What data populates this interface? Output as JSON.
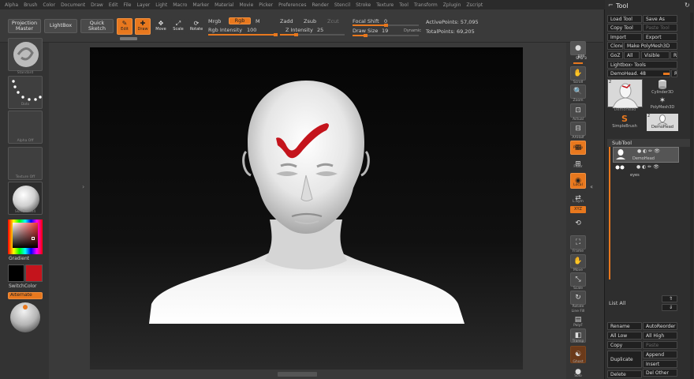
{
  "menubar": {
    "items": [
      "Alpha",
      "Brush",
      "Color",
      "Document",
      "Draw",
      "Edit",
      "File",
      "Layer",
      "Light",
      "Macro",
      "Marker",
      "Material",
      "Movie",
      "Picker",
      "Preferences",
      "Render",
      "Stencil",
      "Stroke",
      "Texture",
      "Tool",
      "Transform",
      "Zplugin",
      "Zscript"
    ]
  },
  "toolbar": {
    "projection_master": "Projection Master",
    "lightbox": "LightBox",
    "quick_sketch": "Quick Sketch",
    "edit": "Edit",
    "draw": "Draw",
    "move": "Move",
    "scale": "Scale",
    "rotate": "Rotate",
    "mrgb": "Mrgb",
    "rgb": "Rgb",
    "m": "M",
    "rgb_intensity_label": "Rgb Intensity",
    "rgb_intensity_value": "100",
    "zadd": "Zadd",
    "zsub": "Zsub",
    "zcut": "Zcut",
    "z_intensity_label": "Z Intensity",
    "z_intensity_value": "25",
    "focal_shift_label": "Focal Shift",
    "focal_shift_value": "0",
    "draw_size_label": "Draw Size",
    "draw_size_value": "19",
    "dynamic": "Dynamic",
    "active_points": "ActivePoints: 57,095",
    "total_points": "TotalPoints: 69,205",
    "rgb_intensity_fraction": 1.0,
    "z_intensity_fraction": 0.25,
    "focal_shift_fraction": 0.5,
    "draw_size_fraction": 0.2
  },
  "left_tray": {
    "standard": "Standard",
    "dots": "Dots",
    "alpha_off": "Alpha Off",
    "texture_off": "Texture Off",
    "matcap": "SkinShade4",
    "gradient": "Gradient",
    "switch_color": "SwitchColor",
    "alternate": "Alternate"
  },
  "right_tray": {
    "bpr": "BPR",
    "spix_label": "SPix",
    "spix_value": "3",
    "scroll": "Scroll",
    "zoom": "Zoom",
    "actual": "Actual",
    "aahalf": "AAHalf",
    "persp": "Persp",
    "floor": "Floor",
    "local": "Local",
    "lsym": "L.Sym",
    "xyz": "XYZ",
    "frame": "Frame",
    "move": "Move",
    "scale": "Scale",
    "rotate": "Rotate",
    "line_fill": "Line Fill",
    "polyf": "PolyF",
    "transp": "Transp",
    "ghost": "Ghost",
    "solo": "Solo"
  },
  "tool_panel": {
    "title": "Tool",
    "load_tool": "Load Tool",
    "save_as": "Save As",
    "copy_tool": "Copy Tool",
    "paste_tool": "Paste Tool",
    "import": "Import",
    "export": "Export",
    "clone": "Clone",
    "make_polymesh": "Make PolyMesh3D",
    "goz": "GoZ",
    "all": "All",
    "visible": "Visible",
    "r": "R",
    "lightbox_tools": "Lightbox› Tools",
    "current_tool": "DemoHead. 48",
    "tool_thumbs": [
      {
        "name": "DemoHead",
        "badge": "2"
      },
      {
        "name": "Cylinder3D",
        "badge": ""
      },
      {
        "name": "PolyMesh3D",
        "badge": ""
      },
      {
        "name": "SimpleBrush",
        "badge": ""
      },
      {
        "name": "DemoHead",
        "badge": "2"
      }
    ],
    "subtool_title": "SubTool",
    "subtools": [
      "DemoHead",
      "eyes"
    ],
    "subtool_empty_count": 7,
    "list_all": "List All",
    "rename": "Rename",
    "auto_reorder": "AutoReorder",
    "all_low": "All Low",
    "all_high": "All High",
    "copy": "Copy",
    "paste": "Paste",
    "append": "Append",
    "duplicate": "Duplicate",
    "insert": "Insert",
    "delete": "Delete",
    "del_other": "Del Other"
  },
  "colors": {
    "accent": "#e8781e",
    "stroke": "#c4141c",
    "primary_color": "#000000",
    "secondary_color": "#c4141c"
  }
}
